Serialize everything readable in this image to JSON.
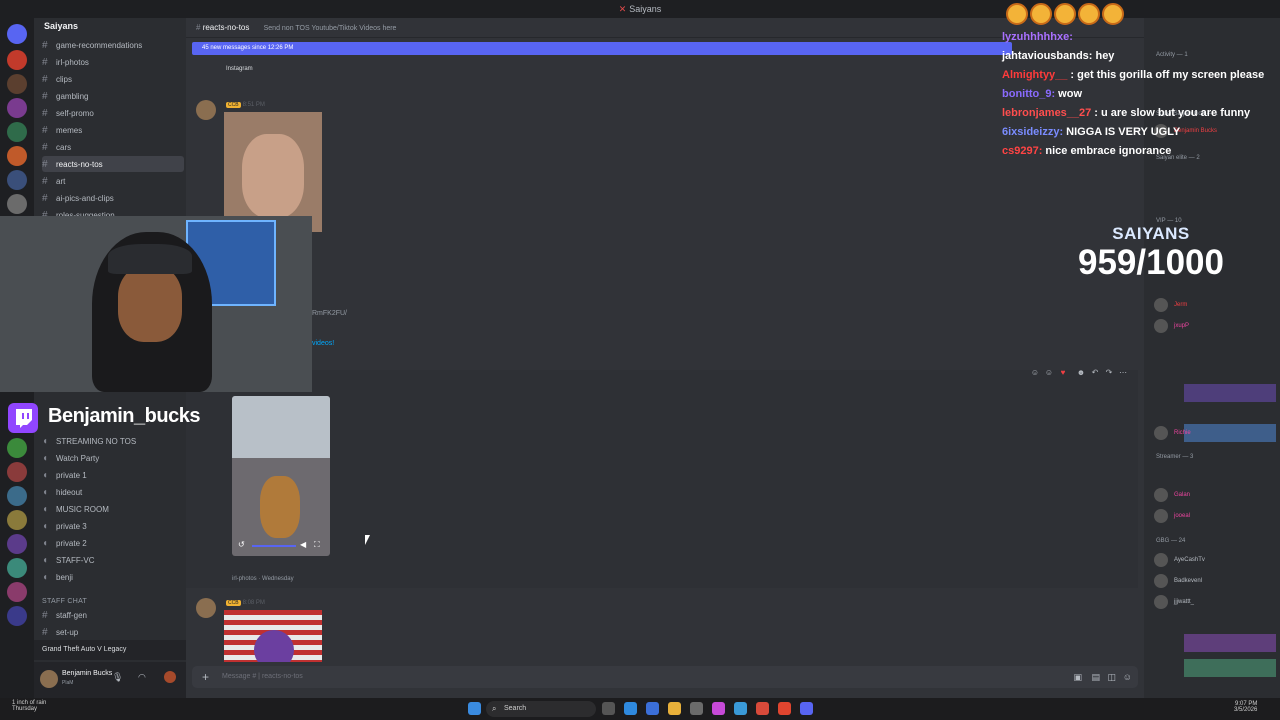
{
  "window": {
    "title": "Saiyans"
  },
  "server": {
    "name": "Saiyans"
  },
  "channels": [
    {
      "name": "game-recommendations"
    },
    {
      "name": "irl-photos"
    },
    {
      "name": "clips"
    },
    {
      "name": "gambling"
    },
    {
      "name": "self-promo"
    },
    {
      "name": "memes"
    },
    {
      "name": "cars"
    },
    {
      "name": "reacts-no-tos"
    },
    {
      "name": "art"
    },
    {
      "name": "ai-pics-and-clips"
    },
    {
      "name": "roles-suggestion"
    }
  ],
  "voice_channels": [
    {
      "name": "STREAMING NO TOS"
    },
    {
      "name": "Watch Party"
    },
    {
      "name": "private 1"
    },
    {
      "name": "hideout"
    },
    {
      "name": "MUSIC ROOM"
    },
    {
      "name": "private 3"
    },
    {
      "name": "private 2"
    },
    {
      "name": "STAFF-VC"
    },
    {
      "name": "benji"
    }
  ],
  "staff": {
    "category": "STAFF CHAT",
    "channels": [
      "staff-gen",
      "set-up"
    ]
  },
  "activity": {
    "label": "Grand Theft Auto V Legacy"
  },
  "user": {
    "name": "Benjamin Bucks",
    "status": "PlaM"
  },
  "chat": {
    "channel": "reacts-no-tos",
    "topic": "Send non TOS Youtube/Tiktok Videos here",
    "new_messages": "45 new messages since 12:26 PM",
    "embed_label": "Instagram",
    "time1": "8:51 PM",
    "time2": "8:08 PM",
    "link_fragment": "RmFK2FU/",
    "videos_label": "videos!",
    "video_caption": "irl-photos · Wednesday",
    "composer_placeholder": "Message # | reacts-no-tos",
    "tag": "CCB"
  },
  "overlay": {
    "streamer": "Benjamin_bucks",
    "goal_title": "SAIYANS",
    "goal_value": "959/1000",
    "chat": [
      {
        "user": "lyzuhhhhhxe:",
        "text": "",
        "color": "#a970ff"
      },
      {
        "user": "jahtaviousbands:",
        "text": "hey",
        "color": "#ffffff"
      },
      {
        "user": "Almightyy__",
        "text": ": get this gorilla off my screen please",
        "color": "#ff3b3b"
      },
      {
        "user": "bonitto_9:",
        "text": "wow",
        "color": "#8a6bff"
      },
      {
        "user": "lebronjames__27",
        "text": ": u are slow but you are funny",
        "color": "#ff4e4e"
      },
      {
        "user": "6ixsideizzy:",
        "text": "NIGGA IS VERY UGLY",
        "color": "#7a8cff"
      },
      {
        "user": "cs9297:",
        "text": "nice embrace ignorance",
        "color": "#ff4444"
      }
    ]
  },
  "members": {
    "groups": [
      {
        "label": "Activity — 1"
      },
      {
        "label": "Super Saiyan God — 1"
      },
      {
        "label": "Saiyan elite — 2"
      },
      {
        "label": "VIP — 10"
      },
      {
        "label": "Streamer — 3"
      },
      {
        "label": "GBG — 24"
      }
    ],
    "list": [
      {
        "name": "Benjamin Bucks",
        "color": "#f23f43"
      },
      {
        "name": "Jerm",
        "color": "#f23f43"
      },
      {
        "name": "jxupP",
        "color": "#eb459e"
      },
      {
        "name": "Richie",
        "color": "#eb459e"
      },
      {
        "name": "Galan",
        "color": "#eb459e"
      },
      {
        "name": "jooeal",
        "color": "#eb459e"
      },
      {
        "name": "AyeCashTv",
        "color": "#b5bac1"
      },
      {
        "name": "Badkevenl",
        "color": "#b5bac1"
      },
      {
        "name": "jjjwattt_",
        "color": "#b5bac1"
      }
    ]
  },
  "taskbar": {
    "weather": "1 inch of rain",
    "day": "Thursday",
    "search": "Search",
    "time": "9:07 PM",
    "date": "3/5/2026"
  }
}
